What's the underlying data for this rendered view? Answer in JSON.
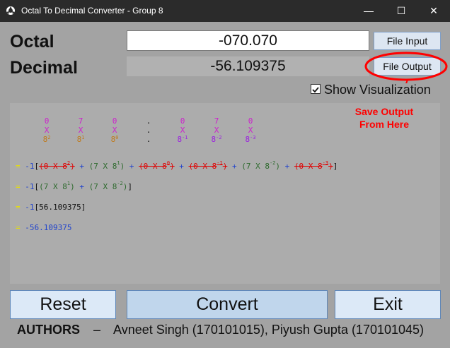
{
  "window": {
    "title": "Octal To Decimal Converter - Group 8",
    "minimize": "—",
    "maximize": "☐",
    "close": "✕"
  },
  "octal": {
    "label": "Octal",
    "value": "-070.070"
  },
  "decimal": {
    "label": "Decimal",
    "value": "-56.109375"
  },
  "buttons": {
    "file_input": "File Input",
    "file_output": "File Output",
    "reset": "Reset",
    "convert": "Convert",
    "exit": "Exit"
  },
  "visualization": {
    "checkbox_label": "Show Visualization",
    "checked": true
  },
  "annotation": {
    "line1": "Save Output",
    "line2": "From Here"
  },
  "viz": {
    "digits": [
      "0",
      "7",
      "0",
      ".",
      "0",
      "7",
      "0"
    ],
    "times": "X",
    "powers": [
      {
        "base": "8",
        "exp": "2"
      },
      {
        "base": "8",
        "exp": "1"
      },
      {
        "base": "8",
        "exp": "0"
      },
      {
        "base": ".",
        "exp": ""
      },
      {
        "base": "8",
        "exp": "-1"
      },
      {
        "base": "8",
        "exp": "-2"
      },
      {
        "base": "8",
        "exp": "-3"
      }
    ],
    "eq": "=",
    "neg": "-1",
    "open": "[",
    "close": "]",
    "plus": "+",
    "line1_terms": [
      {
        "a": "0",
        "b": "8",
        "e": "2",
        "zero": true
      },
      {
        "a": "7",
        "b": "8",
        "e": "1",
        "zero": false
      },
      {
        "a": "0",
        "b": "8",
        "e": "0",
        "zero": true
      },
      {
        "a": "0",
        "b": "8",
        "e": "-1",
        "zero": true
      },
      {
        "a": "7",
        "b": "8",
        "e": "-2",
        "zero": false
      },
      {
        "a": "0",
        "b": "8",
        "e": "-3",
        "zero": true
      }
    ],
    "line2_terms": [
      {
        "a": "7",
        "b": "8",
        "e": "1"
      },
      {
        "a": "7",
        "b": "8",
        "e": "-2"
      }
    ],
    "line3_value": "56.109375",
    "line4_value": "-56.109375"
  },
  "authors": {
    "label": "AUTHORS",
    "dash": "–",
    "names": "Avneet Singh (170101015), Piyush Gupta (170101045)"
  },
  "colors": {
    "digit": "#cc22cc",
    "orange": "#c07a1a",
    "purple": "#9b1fe0",
    "red": "#e00000",
    "green": "#2f6b2f",
    "blue": "#2244cc",
    "yellow": "#e8e100"
  }
}
